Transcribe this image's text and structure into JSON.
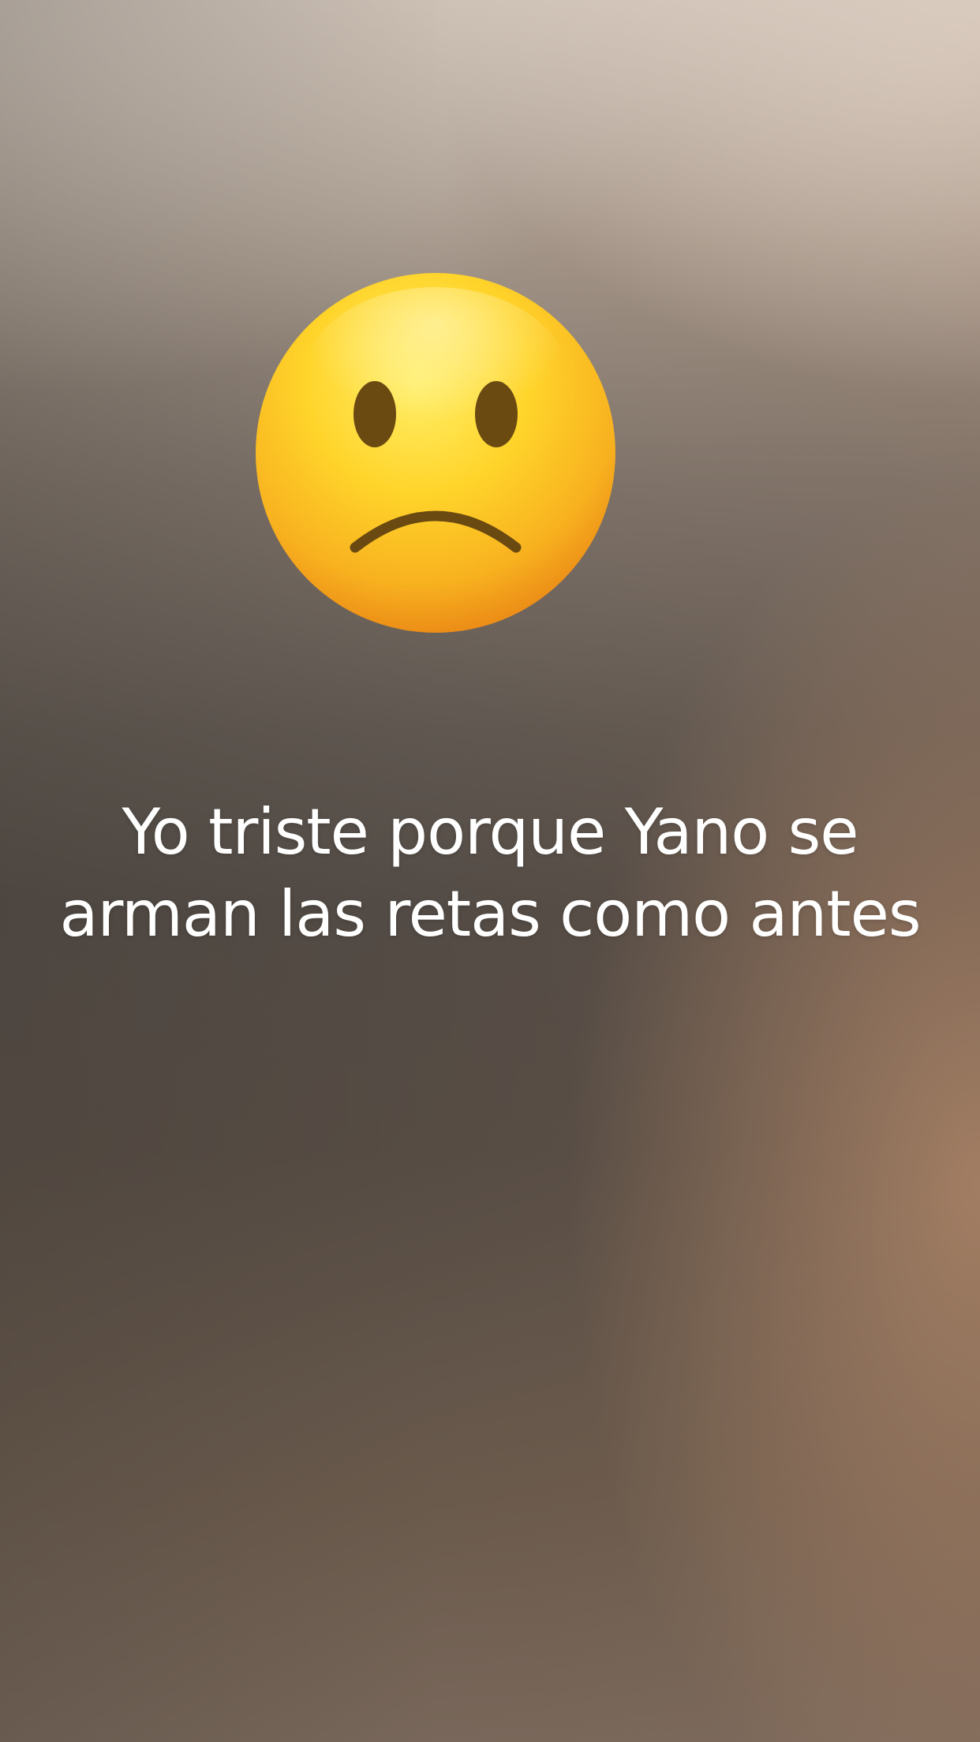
{
  "emoji": {
    "icon": "slightly-frowning-face-icon",
    "colors": {
      "face_light": "#ffe34a",
      "face_mid": "#fcc21b",
      "face_dark": "#f19a1b",
      "features": "#6b4a12"
    }
  },
  "caption": {
    "line1": "Yo triste porque Yano se",
    "line2": "arman las retas como antes"
  }
}
